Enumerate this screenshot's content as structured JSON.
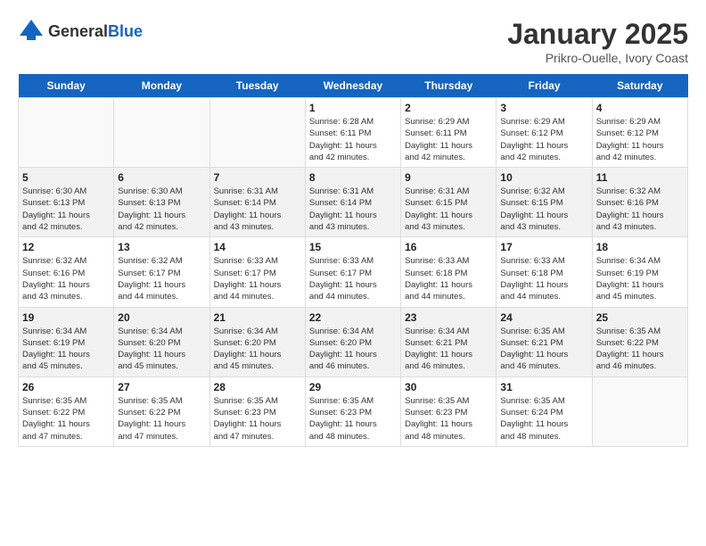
{
  "logo": {
    "text_general": "General",
    "text_blue": "Blue"
  },
  "header": {
    "title": "January 2025",
    "subtitle": "Prikro-Ouelle, Ivory Coast"
  },
  "weekdays": [
    "Sunday",
    "Monday",
    "Tuesday",
    "Wednesday",
    "Thursday",
    "Friday",
    "Saturday"
  ],
  "weeks": [
    [
      {
        "day": "",
        "info": ""
      },
      {
        "day": "",
        "info": ""
      },
      {
        "day": "",
        "info": ""
      },
      {
        "day": "1",
        "info": "Sunrise: 6:28 AM\nSunset: 6:11 PM\nDaylight: 11 hours\nand 42 minutes."
      },
      {
        "day": "2",
        "info": "Sunrise: 6:29 AM\nSunset: 6:11 PM\nDaylight: 11 hours\nand 42 minutes."
      },
      {
        "day": "3",
        "info": "Sunrise: 6:29 AM\nSunset: 6:12 PM\nDaylight: 11 hours\nand 42 minutes."
      },
      {
        "day": "4",
        "info": "Sunrise: 6:29 AM\nSunset: 6:12 PM\nDaylight: 11 hours\nand 42 minutes."
      }
    ],
    [
      {
        "day": "5",
        "info": "Sunrise: 6:30 AM\nSunset: 6:13 PM\nDaylight: 11 hours\nand 42 minutes."
      },
      {
        "day": "6",
        "info": "Sunrise: 6:30 AM\nSunset: 6:13 PM\nDaylight: 11 hours\nand 42 minutes."
      },
      {
        "day": "7",
        "info": "Sunrise: 6:31 AM\nSunset: 6:14 PM\nDaylight: 11 hours\nand 43 minutes."
      },
      {
        "day": "8",
        "info": "Sunrise: 6:31 AM\nSunset: 6:14 PM\nDaylight: 11 hours\nand 43 minutes."
      },
      {
        "day": "9",
        "info": "Sunrise: 6:31 AM\nSunset: 6:15 PM\nDaylight: 11 hours\nand 43 minutes."
      },
      {
        "day": "10",
        "info": "Sunrise: 6:32 AM\nSunset: 6:15 PM\nDaylight: 11 hours\nand 43 minutes."
      },
      {
        "day": "11",
        "info": "Sunrise: 6:32 AM\nSunset: 6:16 PM\nDaylight: 11 hours\nand 43 minutes."
      }
    ],
    [
      {
        "day": "12",
        "info": "Sunrise: 6:32 AM\nSunset: 6:16 PM\nDaylight: 11 hours\nand 43 minutes."
      },
      {
        "day": "13",
        "info": "Sunrise: 6:32 AM\nSunset: 6:17 PM\nDaylight: 11 hours\nand 44 minutes."
      },
      {
        "day": "14",
        "info": "Sunrise: 6:33 AM\nSunset: 6:17 PM\nDaylight: 11 hours\nand 44 minutes."
      },
      {
        "day": "15",
        "info": "Sunrise: 6:33 AM\nSunset: 6:17 PM\nDaylight: 11 hours\nand 44 minutes."
      },
      {
        "day": "16",
        "info": "Sunrise: 6:33 AM\nSunset: 6:18 PM\nDaylight: 11 hours\nand 44 minutes."
      },
      {
        "day": "17",
        "info": "Sunrise: 6:33 AM\nSunset: 6:18 PM\nDaylight: 11 hours\nand 44 minutes."
      },
      {
        "day": "18",
        "info": "Sunrise: 6:34 AM\nSunset: 6:19 PM\nDaylight: 11 hours\nand 45 minutes."
      }
    ],
    [
      {
        "day": "19",
        "info": "Sunrise: 6:34 AM\nSunset: 6:19 PM\nDaylight: 11 hours\nand 45 minutes."
      },
      {
        "day": "20",
        "info": "Sunrise: 6:34 AM\nSunset: 6:20 PM\nDaylight: 11 hours\nand 45 minutes."
      },
      {
        "day": "21",
        "info": "Sunrise: 6:34 AM\nSunset: 6:20 PM\nDaylight: 11 hours\nand 45 minutes."
      },
      {
        "day": "22",
        "info": "Sunrise: 6:34 AM\nSunset: 6:20 PM\nDaylight: 11 hours\nand 46 minutes."
      },
      {
        "day": "23",
        "info": "Sunrise: 6:34 AM\nSunset: 6:21 PM\nDaylight: 11 hours\nand 46 minutes."
      },
      {
        "day": "24",
        "info": "Sunrise: 6:35 AM\nSunset: 6:21 PM\nDaylight: 11 hours\nand 46 minutes."
      },
      {
        "day": "25",
        "info": "Sunrise: 6:35 AM\nSunset: 6:22 PM\nDaylight: 11 hours\nand 46 minutes."
      }
    ],
    [
      {
        "day": "26",
        "info": "Sunrise: 6:35 AM\nSunset: 6:22 PM\nDaylight: 11 hours\nand 47 minutes."
      },
      {
        "day": "27",
        "info": "Sunrise: 6:35 AM\nSunset: 6:22 PM\nDaylight: 11 hours\nand 47 minutes."
      },
      {
        "day": "28",
        "info": "Sunrise: 6:35 AM\nSunset: 6:23 PM\nDaylight: 11 hours\nand 47 minutes."
      },
      {
        "day": "29",
        "info": "Sunrise: 6:35 AM\nSunset: 6:23 PM\nDaylight: 11 hours\nand 48 minutes."
      },
      {
        "day": "30",
        "info": "Sunrise: 6:35 AM\nSunset: 6:23 PM\nDaylight: 11 hours\nand 48 minutes."
      },
      {
        "day": "31",
        "info": "Sunrise: 6:35 AM\nSunset: 6:24 PM\nDaylight: 11 hours\nand 48 minutes."
      },
      {
        "day": "",
        "info": ""
      }
    ]
  ]
}
